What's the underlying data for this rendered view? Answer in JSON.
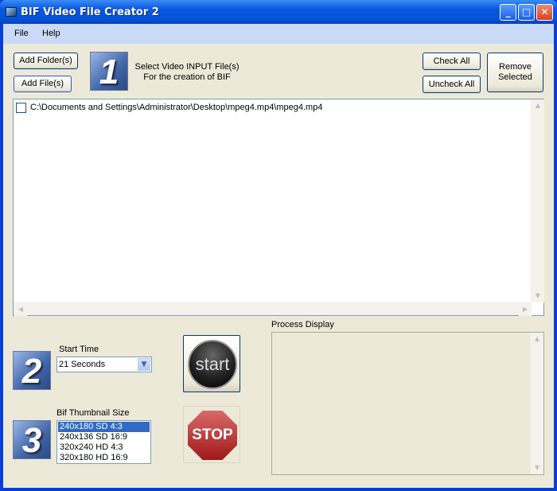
{
  "window": {
    "title": "BIF Video File Creator 2",
    "min": "_",
    "max": "□",
    "close": "✕"
  },
  "menu": [
    "File",
    "Help"
  ],
  "step1": {
    "number": "1",
    "line1": "Select Video INPUT File(s)",
    "line2": "For the creation of BIF",
    "add_folder": "Add Folder(s)",
    "add_files": "Add File(s)",
    "check_all": "Check All",
    "uncheck_all": "Uncheck All",
    "remove_selected_1": "Remove",
    "remove_selected_2": "Selected"
  },
  "files": [
    {
      "path": "C:\\Documents and Settings\\Administrator\\Desktop\\mpeg4.mp4\\mpeg4.mp4",
      "checked": false
    }
  ],
  "step2": {
    "number": "2",
    "label": "Start Time",
    "value": "21 Seconds"
  },
  "step3": {
    "number": "3",
    "label": "Bif Thumbnail Size",
    "options": [
      "240x180 SD 4:3",
      "240x136 SD 16:9",
      "320x240 HD 4:3",
      "320x180 HD 16:9"
    ],
    "selected": 0
  },
  "start_label": "start",
  "stop_label": "STOP",
  "process": {
    "label": "Process Display"
  }
}
